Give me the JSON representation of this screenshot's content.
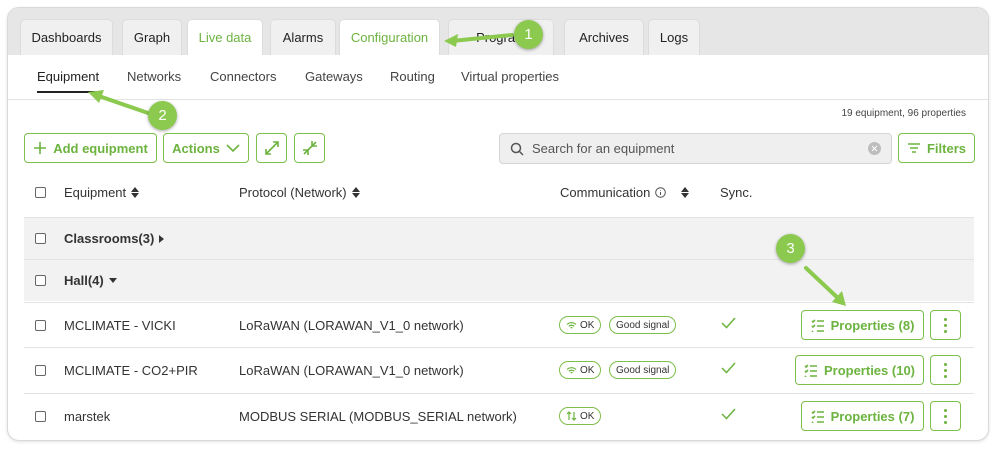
{
  "tabs": [
    {
      "label": "Dashboards",
      "style": "normal"
    },
    {
      "label": "Graph",
      "style": "normal"
    },
    {
      "label": "Live data",
      "style": "green"
    },
    {
      "label": "Alarms",
      "style": "normal"
    },
    {
      "label": "Configuration",
      "style": "active"
    },
    {
      "label": "Program",
      "style": "normal"
    },
    {
      "label": "Archives",
      "style": "normal"
    },
    {
      "label": "Logs",
      "style": "normal"
    }
  ],
  "subnav": [
    "Equipment",
    "Networks",
    "Connectors",
    "Gateways",
    "Routing",
    "Virtual properties"
  ],
  "summary": "19 equipment, 96 properties",
  "toolbar": {
    "add_label": "Add equipment",
    "actions_label": "Actions",
    "search_placeholder": "Search for an equipment",
    "filters_label": "Filters"
  },
  "columns": {
    "equipment": "Equipment",
    "protocol": "Protocol (Network)",
    "communication": "Communication",
    "sync": "Sync."
  },
  "groups": [
    {
      "label": "Classrooms(3)",
      "expanded": false
    },
    {
      "label": "Hall(4)",
      "expanded": true
    }
  ],
  "rows": [
    {
      "name": "MCLIMATE - VICKI",
      "protocol": "LoRaWAN (LORAWAN_V1_0 network)",
      "status": "OK",
      "signal": "Good signal",
      "comm_icon": "wifi-icon",
      "synced": true,
      "properties_label": "Properties (8)"
    },
    {
      "name": "MCLIMATE - CO2+PIR",
      "protocol": "LoRaWAN (LORAWAN_V1_0 network)",
      "status": "OK",
      "signal": "Good signal",
      "comm_icon": "wifi-icon",
      "synced": true,
      "properties_label": "Properties (10)"
    },
    {
      "name": "marstek",
      "protocol": "MODBUS SERIAL (MODBUS_SERIAL network)",
      "status": "OK",
      "signal": "",
      "comm_icon": "transfer-icon",
      "synced": true,
      "properties_label": "Properties (7)"
    }
  ],
  "annotations": [
    "1",
    "2",
    "3"
  ],
  "colors": {
    "accent": "#6cb33f",
    "badge": "#8bc94f",
    "tabbar": "#e6e6e6"
  }
}
